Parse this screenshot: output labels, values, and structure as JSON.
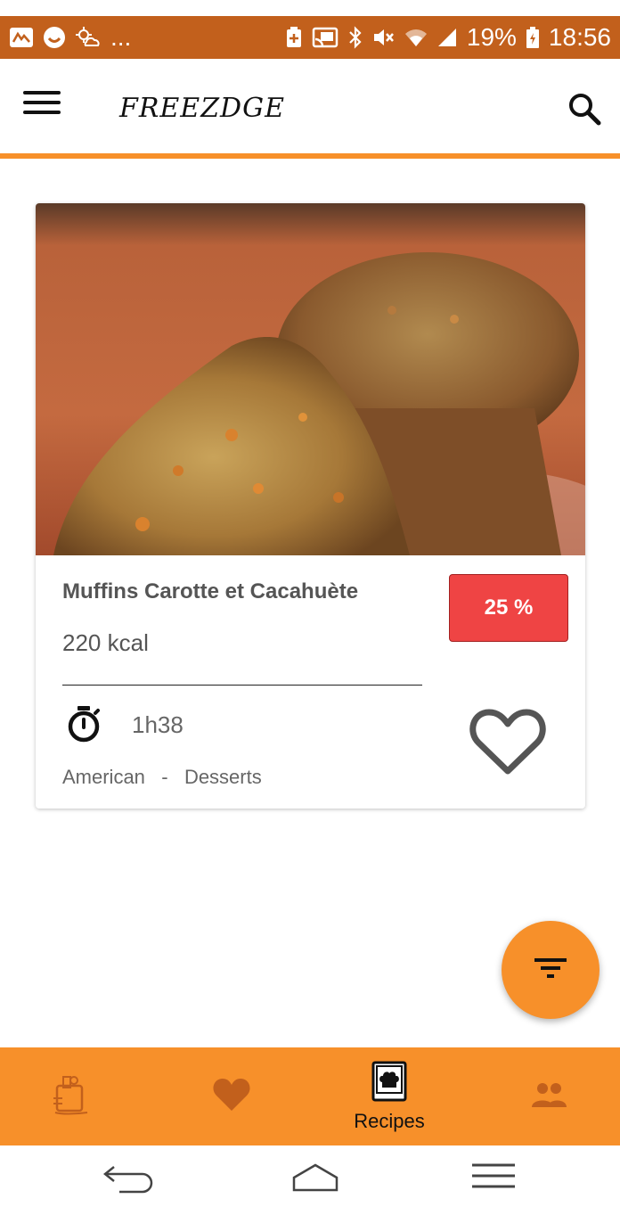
{
  "status_bar": {
    "left_icons": [
      "app-notification-icon",
      "face-notification-icon",
      "weather-icon"
    ],
    "left_more": "...",
    "right_icons": [
      "battery-saver-icon",
      "cast-icon",
      "bluetooth-icon",
      "mute-icon",
      "wifi-icon",
      "signal-icon",
      "charging-icon"
    ],
    "battery_text": "19%",
    "time": "18:56"
  },
  "app_bar": {
    "title": "FREEZDGE",
    "menu_icon": "hamburger-menu-icon",
    "search_icon": "search-icon"
  },
  "recipe_card": {
    "title": "Muffins Carotte et Cacahuète",
    "calories": "220 kcal",
    "discount": "25 %",
    "duration": "1h38",
    "cuisine": "American",
    "separator": "-",
    "category": "Desserts",
    "timer_icon": "stopwatch-icon",
    "favorite_icon": "heart-outline-icon"
  },
  "fab": {
    "icon": "filter-icon"
  },
  "bottom_nav": {
    "items": [
      {
        "name": "fridge-groceries",
        "icon": "groceries-icon",
        "label": ""
      },
      {
        "name": "favorites",
        "icon": "heart-icon",
        "label": ""
      },
      {
        "name": "recipes",
        "icon": "recipe-book-icon",
        "label": "Recipes",
        "active": true
      },
      {
        "name": "community",
        "icon": "people-icon",
        "label": ""
      }
    ]
  },
  "system_nav": {
    "back_icon": "back-icon",
    "home_icon": "home-icon",
    "recents_icon": "recents-icon"
  },
  "colors": {
    "status_bar": "#c2601c",
    "accent": "#f7902a",
    "discount": "#ef4444",
    "text_muted": "#555555"
  }
}
